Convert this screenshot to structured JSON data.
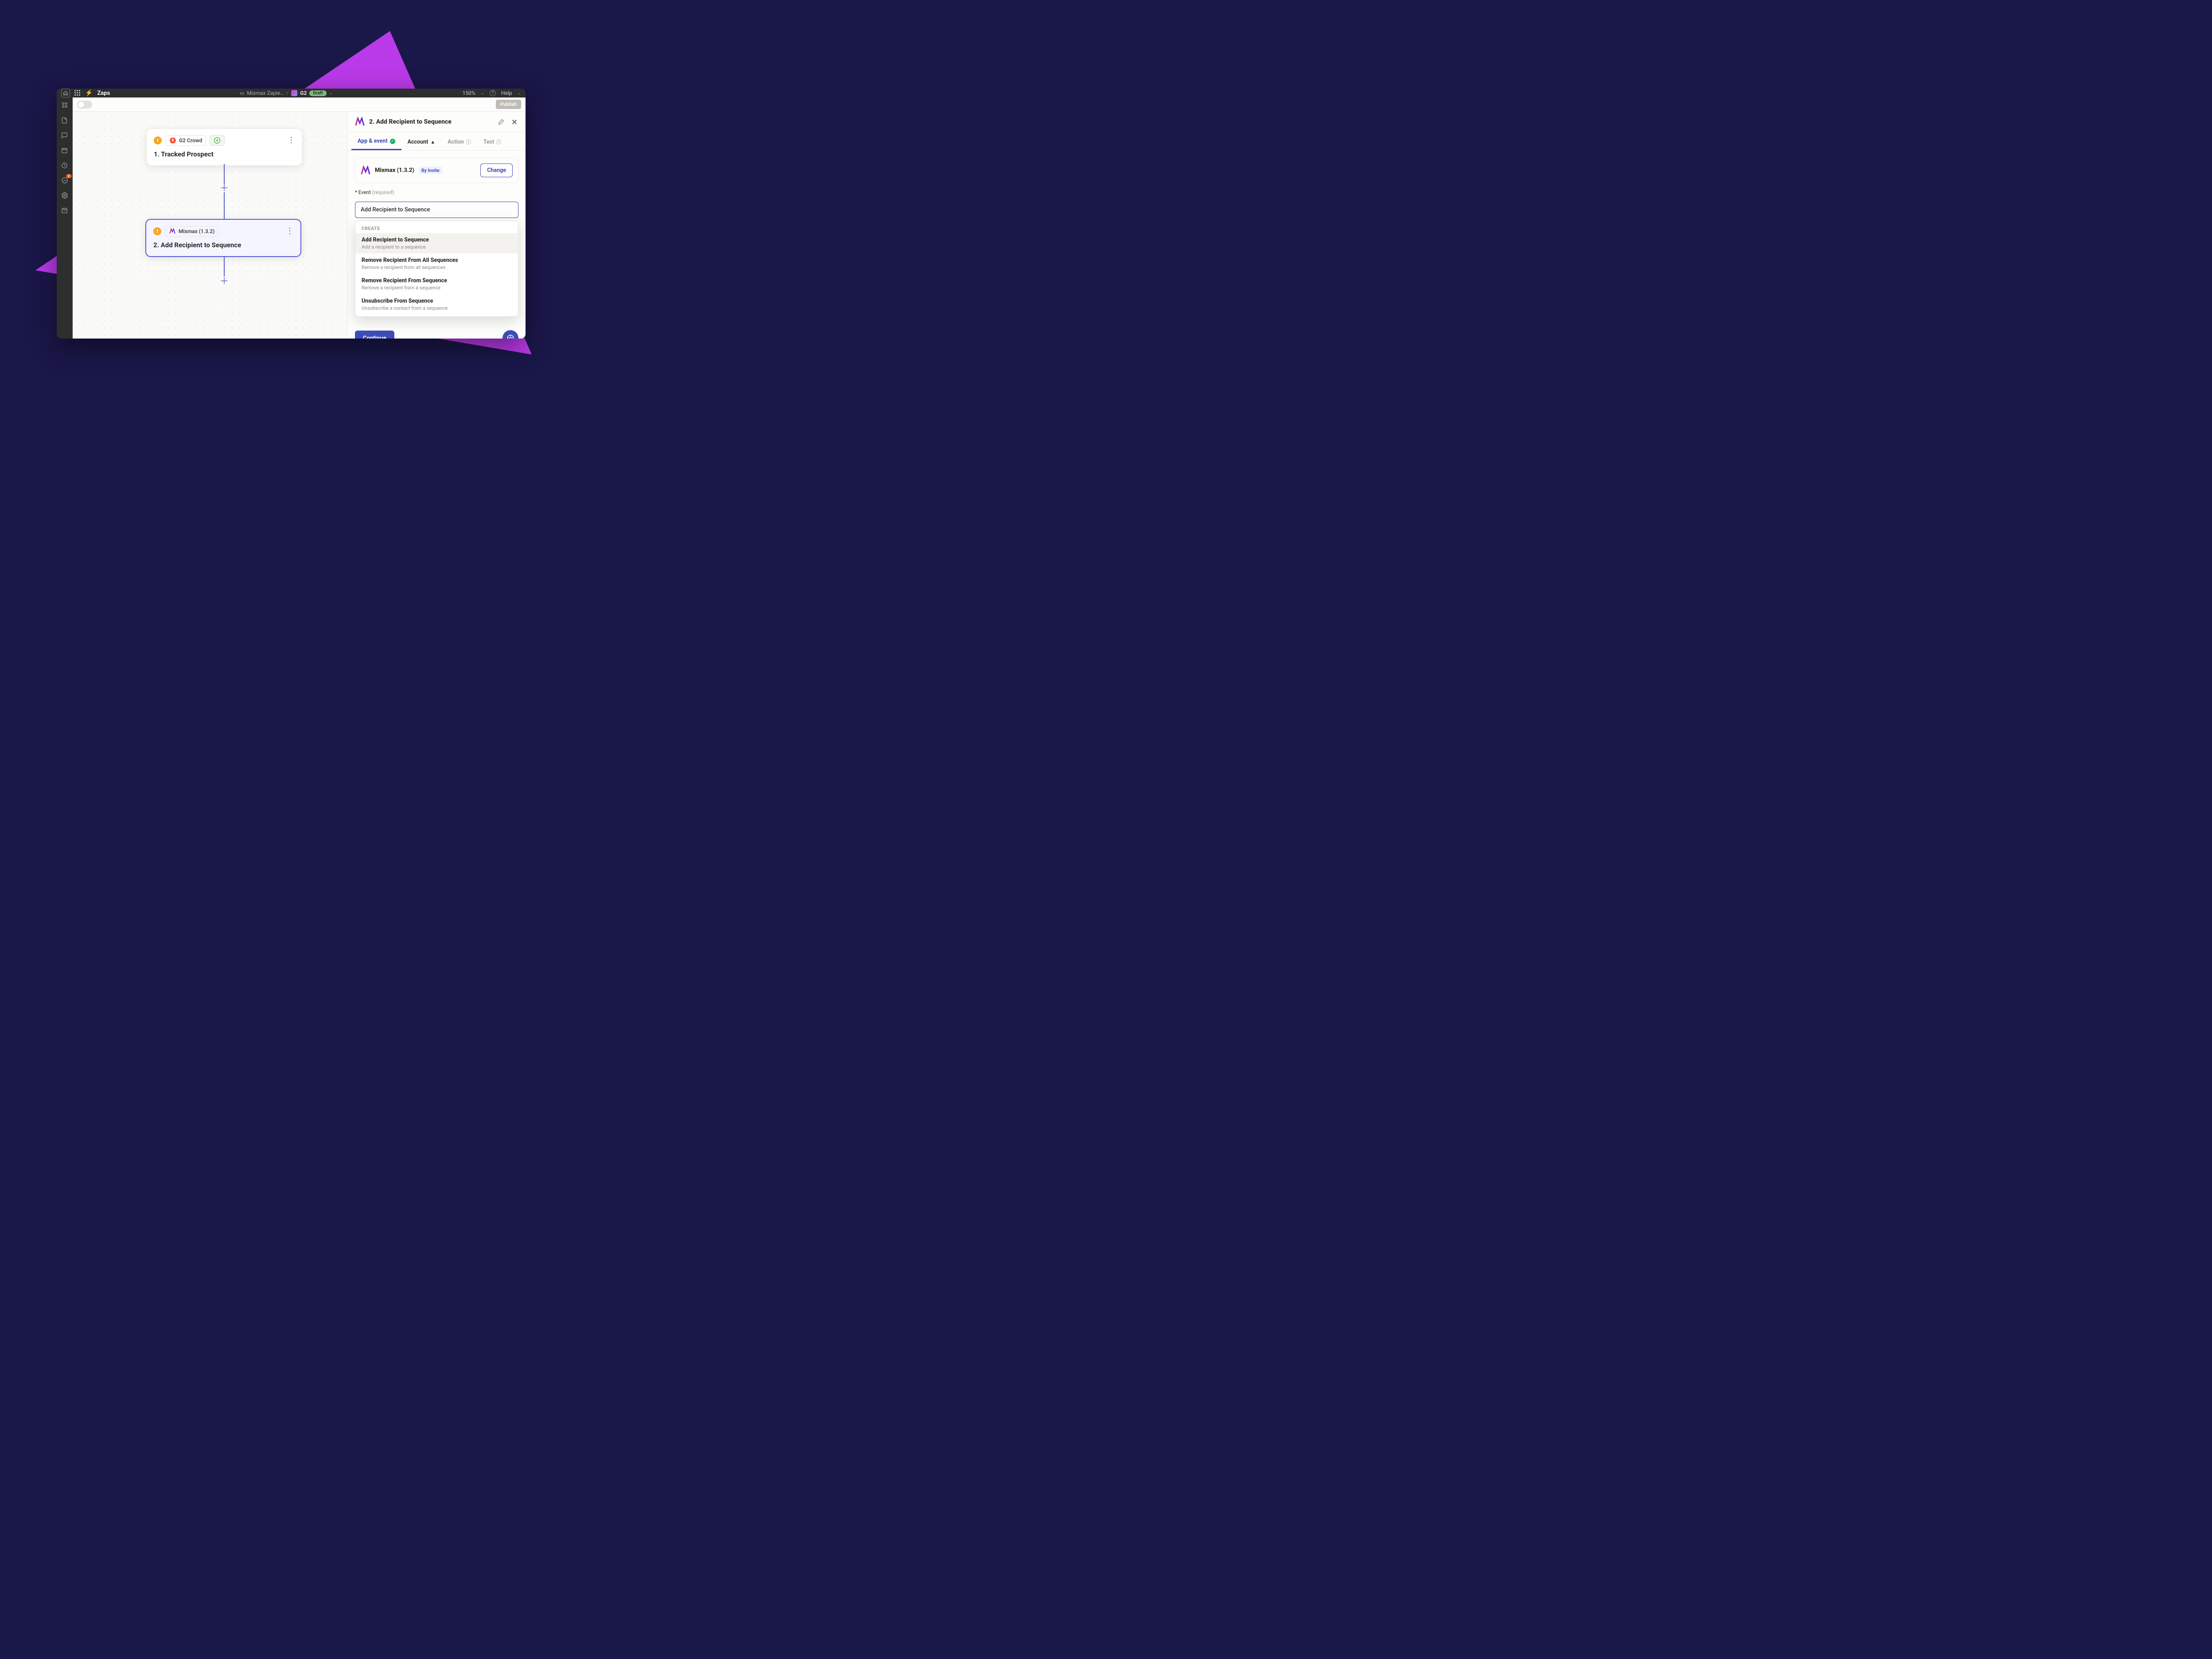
{
  "titlebar": {
    "section": "Zaps",
    "folder": "Mixmax Zapie…",
    "zap_name": "G2",
    "status": "Draft",
    "zoom": "150%",
    "help": "Help"
  },
  "toolbar": {
    "publish": "Publish"
  },
  "rail": {
    "badge": "2"
  },
  "canvas": {
    "node1": {
      "app": "G2 Crowd",
      "title": "1. Tracked Prospect"
    },
    "node2": {
      "app": "Mixmax (1.3.2)",
      "title": "2. Add Recipient to Sequence"
    }
  },
  "panel": {
    "title": "2. Add Recipient to Sequence",
    "tabs": {
      "app_event": "App & event",
      "account": "Account",
      "action": "Action",
      "test": "Test"
    },
    "app": {
      "name": "Mixmax (1.3.2)",
      "invite": "By Invite",
      "change": "Change"
    },
    "field": {
      "label": "* Event",
      "required": "(required)",
      "value": "Add Recipient to Sequence"
    },
    "dropdown": {
      "section": "CREATE",
      "items": [
        {
          "t": "Add Recipient to Sequence",
          "d": "Add a recipient to a sequence"
        },
        {
          "t": "Remove Recipient From All Sequences",
          "d": "Remove a recipient from all sequences"
        },
        {
          "t": "Remove Recipient From Sequence",
          "d": "Remove a recipient from a sequence"
        },
        {
          "t": "Unsubscribe From Sequence",
          "d": "Unsubscribe a contact from a sequence"
        }
      ]
    },
    "continue": "Continue"
  }
}
